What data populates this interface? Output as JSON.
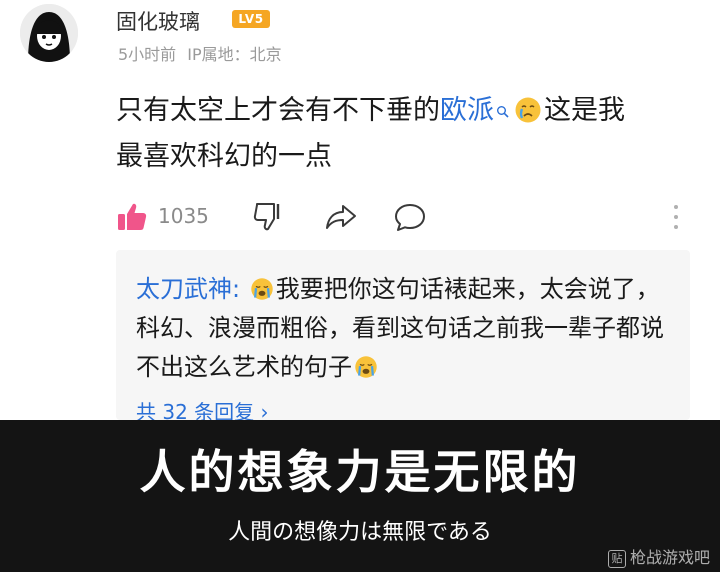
{
  "post": {
    "username": "固化玻璃",
    "level_badge": "LV5",
    "time": "5小时前",
    "ip_location": "IP属地：北京",
    "comment_line1_before": "只有太空上才会有不下垂的",
    "comment_link": "欧派",
    "comment_line1_after": "这是我",
    "comment_line2": "最喜欢科幻的一点",
    "like_count": "1035"
  },
  "reply": {
    "author": "太刀武神:",
    "text_part1": "我要把你这句话裱起来，太会说了，科幻、浪漫而粗俗，看到这句话之前我一辈子都说不出这么艺术的句子",
    "more_replies": "共 32 条回复 ›"
  },
  "caption": {
    "main": "人的想象力是无限的",
    "sub": "人間の想像力は無限である"
  },
  "watermark": {
    "icon_text": "贴",
    "text": "枪战游戏吧"
  },
  "colors": {
    "link_blue": "#2a6fd6",
    "like_pink": "#f0558a",
    "badge_orange": "#f5a623",
    "caption_band": "#141414"
  },
  "icons": [
    "avatar",
    "thumbs-up-icon",
    "thumbs-down-icon",
    "share-icon",
    "comment-icon",
    "more-vertical-icon",
    "crying-emoji-icon",
    "search-icon"
  ]
}
